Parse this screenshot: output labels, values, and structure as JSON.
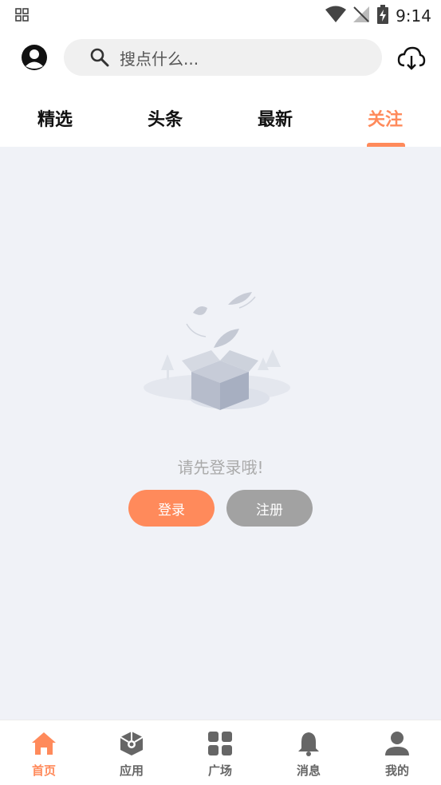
{
  "status_bar": {
    "time": "9:14"
  },
  "search": {
    "placeholder": "搜点什么..."
  },
  "tabs": [
    {
      "label": "精选",
      "active": false
    },
    {
      "label": "头条",
      "active": false
    },
    {
      "label": "最新",
      "active": false
    },
    {
      "label": "关注",
      "active": true
    }
  ],
  "empty_state": {
    "message": "请先登录哦!",
    "login_label": "登录",
    "register_label": "注册"
  },
  "bottom_nav": [
    {
      "label": "首页",
      "icon": "home-icon",
      "active": true
    },
    {
      "label": "应用",
      "icon": "box-icon",
      "active": false
    },
    {
      "label": "广场",
      "icon": "grid-icon",
      "active": false
    },
    {
      "label": "消息",
      "icon": "bell-icon",
      "active": false
    },
    {
      "label": "我的",
      "icon": "person-icon",
      "active": false
    }
  ],
  "colors": {
    "accent": "#ff8a5b",
    "secondary_button": "#a2a2a2",
    "content_bg": "#f0f2f7"
  }
}
